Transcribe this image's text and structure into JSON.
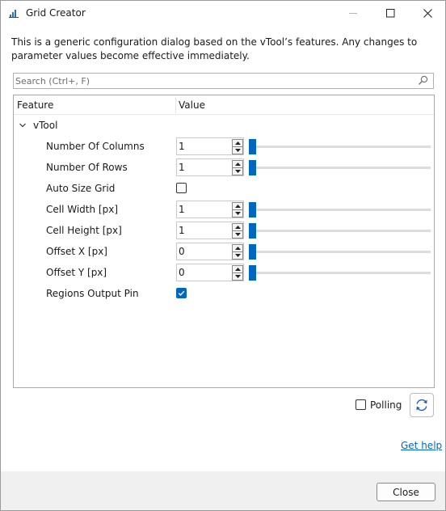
{
  "window": {
    "title": "Grid Creator"
  },
  "description": "This is a generic configuration dialog based on the vTool’s features. Any changes to parameter values become effective immediately.",
  "search": {
    "placeholder": "Search (Ctrl+, F)",
    "value": ""
  },
  "grid": {
    "header": {
      "feature": "Feature",
      "value": "Value"
    },
    "category": "vTool",
    "rows": {
      "columns": {
        "label": "Number Of Columns",
        "value": "1",
        "slider_level": 0
      },
      "rows": {
        "label": "Number Of Rows",
        "value": "1",
        "slider_level": 0
      },
      "autosize": {
        "label": "Auto Size Grid",
        "checked": false
      },
      "cellwidth": {
        "label": "Cell Width [px]",
        "value": "1",
        "slider_level": 0
      },
      "cellheight": {
        "label": "Cell Height [px]",
        "value": "1",
        "slider_level": 0
      },
      "offsetx": {
        "label": "Offset X [px]",
        "value": "0",
        "slider_level": 0
      },
      "offsety": {
        "label": "Offset Y [px]",
        "value": "0",
        "slider_level": 0
      },
      "regions": {
        "label": "Regions Output Pin",
        "checked": true
      }
    }
  },
  "polling": {
    "label": "Polling",
    "checked": false
  },
  "help_link": "Get help",
  "close_label": "Close",
  "colors": {
    "accent": "#0067c0",
    "footer": "#f0f0f0"
  },
  "icons": {
    "app": "grid-creator-app-icon",
    "search": "search-icon",
    "refresh": "refresh-icon"
  }
}
